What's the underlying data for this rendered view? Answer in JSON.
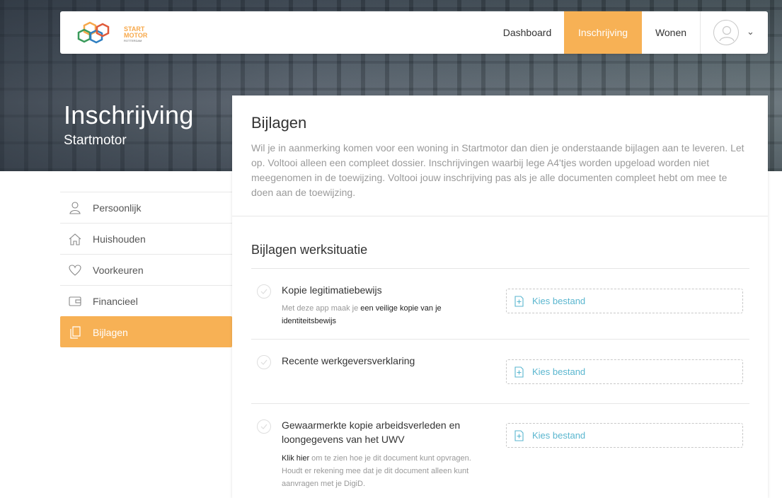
{
  "hero": {
    "title": "Inschrijving",
    "subtitle": "Startmotor"
  },
  "logo": {
    "line1": "START",
    "line2": "MOTOR",
    "line3": "ROTTERDAM"
  },
  "nav": {
    "items": [
      {
        "label": "Dashboard",
        "active": false
      },
      {
        "label": "Inschrijving",
        "active": true
      },
      {
        "label": "Wonen",
        "active": false
      }
    ],
    "accent": "#f7b155"
  },
  "sidebar": {
    "items": [
      {
        "label": "Persoonlijk",
        "icon": "user-icon",
        "active": false
      },
      {
        "label": "Huishouden",
        "icon": "home-icon",
        "active": false
      },
      {
        "label": "Voorkeuren",
        "icon": "heart-icon",
        "active": false
      },
      {
        "label": "Financieel",
        "icon": "wallet-icon",
        "active": false
      },
      {
        "label": "Bijlagen",
        "icon": "document-icon",
        "active": true
      }
    ]
  },
  "card": {
    "title": "Bijlagen",
    "intro": "Wil je in aanmerking komen voor een woning in Startmotor dan dien je onderstaande bijlagen aan te leveren. Let op. Voltooi alleen een compleet dossier. Inschrijvingen waarbij lege A4'tjes worden upgeload worden niet meegenomen in de toewijzing. Voltooi jouw inschrijving pas als je alle documenten compleet hebt om mee te doen aan de toewijzing.",
    "section_title": "Bijlagen werksituatie",
    "documents": [
      {
        "name": "Kopie legitimatiebewijs",
        "note_pre": "Met deze app maak je ",
        "note_link": "een veilige kopie van je identiteitsbewijs",
        "note_post": "",
        "button": "Kies bestand"
      },
      {
        "name": "Recente werkgeversverklaring",
        "button": "Kies bestand"
      },
      {
        "name": "Gewaarmerkte kopie arbeidsverleden en loongegevens van het UWV",
        "note_link": "Klik hier",
        "note_post": " om te zien hoe je dit document kunt opvragen. Houdt er rekening mee dat je dit document alleen kunt aanvragen met je DigiD.",
        "button": "Kies bestand"
      }
    ]
  },
  "colors": {
    "accent": "#f7b155",
    "link": "#5ab6cf"
  }
}
